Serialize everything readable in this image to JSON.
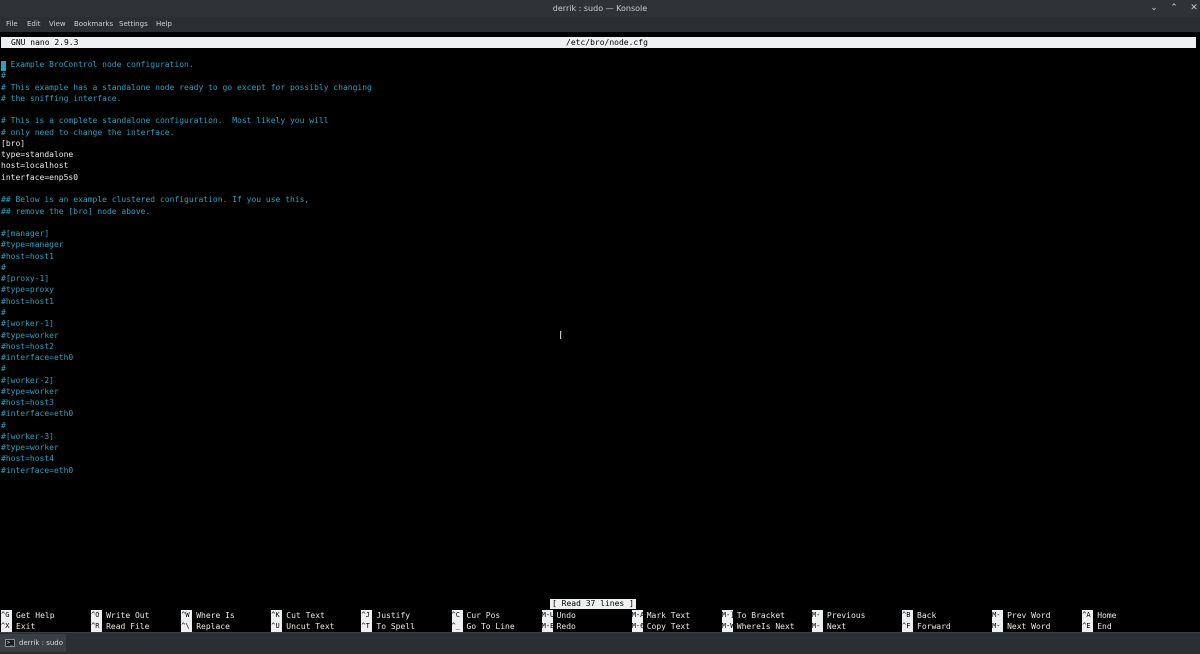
{
  "window": {
    "title": "derrik : sudo — Konsole",
    "minimize_glyph": "⌄",
    "maximize_glyph": "⌃",
    "close_glyph": "✕"
  },
  "menu": [
    "File",
    "Edit",
    "View",
    "Bookmarks",
    "Settings",
    "Help"
  ],
  "nano": {
    "version": "GNU nano 2.9.3",
    "filename": "/etc/bro/node.cfg",
    "status": "[ Read 37 lines ]"
  },
  "file_lines": [
    {
      "t": "# Example BroControl node configuration.",
      "k": "c"
    },
    {
      "t": "#",
      "k": "c"
    },
    {
      "t": "# This example has a standalone node ready to go except for possibly changing",
      "k": "c"
    },
    {
      "t": "# the sniffing interface.",
      "k": "c"
    },
    {
      "t": "",
      "k": "n"
    },
    {
      "t": "# This is a complete standalone configuration.  Most likely you will",
      "k": "c"
    },
    {
      "t": "# only need to change the interface.",
      "k": "c"
    },
    {
      "t": "[bro]",
      "k": "n"
    },
    {
      "t": "type=standalone",
      "k": "n"
    },
    {
      "t": "host=localhost",
      "k": "n"
    },
    {
      "t": "interface=enp5s0",
      "k": "n"
    },
    {
      "t": "",
      "k": "n"
    },
    {
      "t": "## Below is an example clustered configuration. If you use this,",
      "k": "c"
    },
    {
      "t": "## remove the [bro] node above.",
      "k": "c"
    },
    {
      "t": "",
      "k": "n"
    },
    {
      "t": "#[manager]",
      "k": "c"
    },
    {
      "t": "#type=manager",
      "k": "c"
    },
    {
      "t": "#host=host1",
      "k": "c"
    },
    {
      "t": "#",
      "k": "c"
    },
    {
      "t": "#[proxy-1]",
      "k": "c"
    },
    {
      "t": "#type=proxy",
      "k": "c"
    },
    {
      "t": "#host=host1",
      "k": "c"
    },
    {
      "t": "#",
      "k": "c"
    },
    {
      "t": "#[worker-1]",
      "k": "c"
    },
    {
      "t": "#type=worker",
      "k": "c"
    },
    {
      "t": "#host=host2",
      "k": "c"
    },
    {
      "t": "#interface=eth0",
      "k": "c"
    },
    {
      "t": "#",
      "k": "c"
    },
    {
      "t": "#[worker-2]",
      "k": "c"
    },
    {
      "t": "#type=worker",
      "k": "c"
    },
    {
      "t": "#host=host3",
      "k": "c"
    },
    {
      "t": "#interface=eth0",
      "k": "c"
    },
    {
      "t": "#",
      "k": "c"
    },
    {
      "t": "#[worker-3]",
      "k": "c"
    },
    {
      "t": "#type=worker",
      "k": "c"
    },
    {
      "t": "#host=host4",
      "k": "c"
    },
    {
      "t": "#interface=eth0",
      "k": "c"
    }
  ],
  "shortcuts": [
    [
      {
        "key": "^G",
        "label": "Get Help"
      },
      {
        "key": "^X",
        "label": "Exit"
      }
    ],
    [
      {
        "key": "^O",
        "label": "Write Out"
      },
      {
        "key": "^R",
        "label": "Read File"
      }
    ],
    [
      {
        "key": "^W",
        "label": "Where Is"
      },
      {
        "key": "^\\",
        "label": "Replace"
      }
    ],
    [
      {
        "key": "^K",
        "label": "Cut Text"
      },
      {
        "key": "^U",
        "label": "Uncut Text"
      }
    ],
    [
      {
        "key": "^J",
        "label": "Justify"
      },
      {
        "key": "^T",
        "label": "To Spell"
      }
    ],
    [
      {
        "key": "^C",
        "label": "Cur Pos"
      },
      {
        "key": "^_",
        "label": "Go To Line"
      }
    ],
    [
      {
        "key": "M-U",
        "label": "Undo"
      },
      {
        "key": "M-E",
        "label": "Redo"
      }
    ],
    [
      {
        "key": "M-A",
        "label": "Mark Text"
      },
      {
        "key": "M-6",
        "label": "Copy Text"
      }
    ],
    [
      {
        "key": "M-]",
        "label": "To Bracket"
      },
      {
        "key": "M-W",
        "label": "WhereIs Next"
      }
    ],
    [
      {
        "key": "M-",
        "label": "Previous"
      },
      {
        "key": "M-",
        "label": "Next"
      }
    ],
    [
      {
        "key": "^B",
        "label": "Back"
      },
      {
        "key": "^F",
        "label": "Forward"
      }
    ],
    [
      {
        "key": "M-",
        "label": "Prev Word"
      },
      {
        "key": "M-",
        "label": "Next Word"
      }
    ],
    [
      {
        "key": "^A",
        "label": "Home"
      },
      {
        "key": "^E",
        "label": "End"
      }
    ]
  ],
  "tab": {
    "label": "derrik : sudo",
    "icon": ">_"
  }
}
